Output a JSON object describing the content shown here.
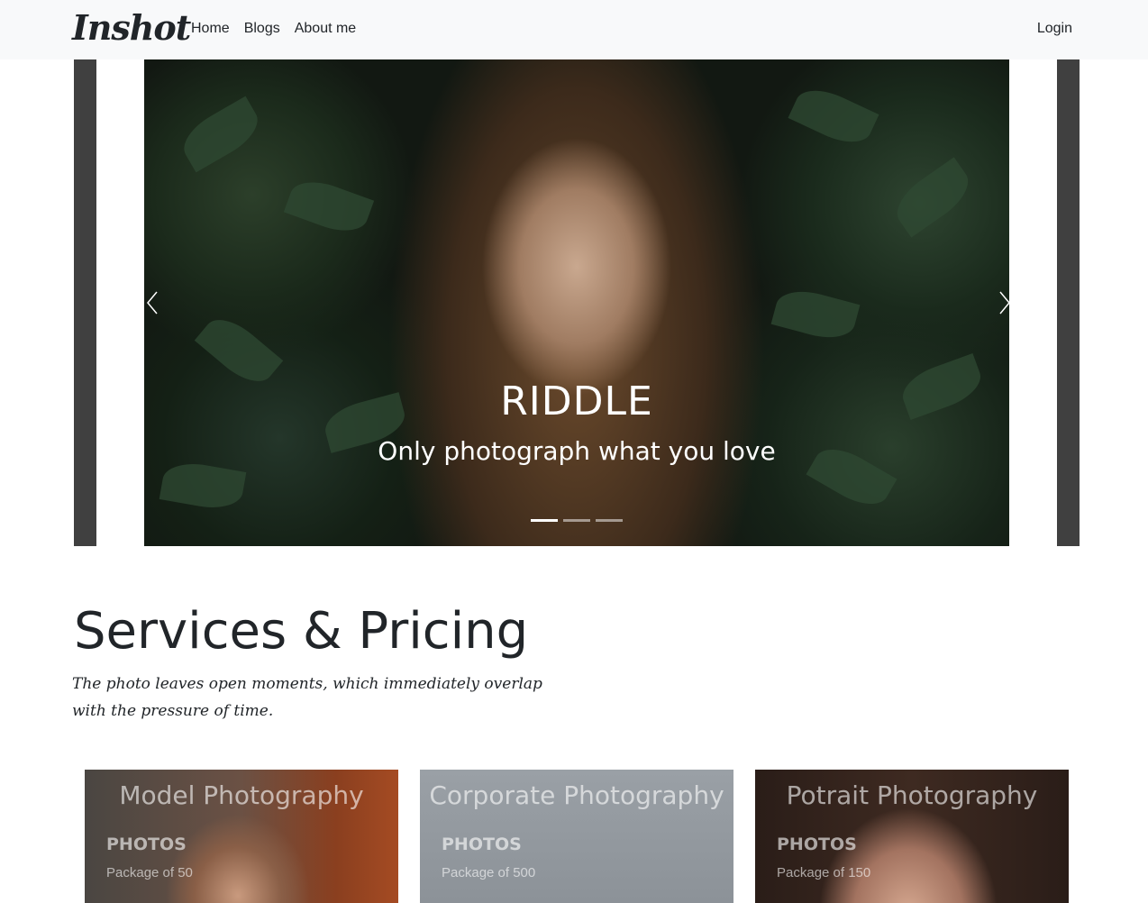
{
  "navbar": {
    "brand": "Inshot",
    "links": [
      "Home",
      "Blogs",
      "About me"
    ],
    "login": "Login"
  },
  "carousel": {
    "title": "RIDDLE",
    "subtitle": "Only photograph what you love",
    "indicator_count": 3,
    "active_indicator": 0,
    "prev_icon": "chevron-left-icon",
    "next_icon": "chevron-right-icon"
  },
  "services": {
    "title": "Services & Pricing",
    "subtitle": "The photo leaves open moments, which immediately overlap with the pressure of time.",
    "cards": [
      {
        "title": "Model Photography",
        "photos_label": "PHOTOS",
        "package": "Package of 50"
      },
      {
        "title": "Corporate Photography",
        "photos_label": "PHOTOS",
        "package": "Package of 500"
      },
      {
        "title": "Potrait Photography",
        "photos_label": "PHOTOS",
        "package": "Package of 150"
      }
    ]
  },
  "colors": {
    "navbar_bg": "#f8f9fa",
    "text": "#212529",
    "carousel_side": "#404040"
  }
}
